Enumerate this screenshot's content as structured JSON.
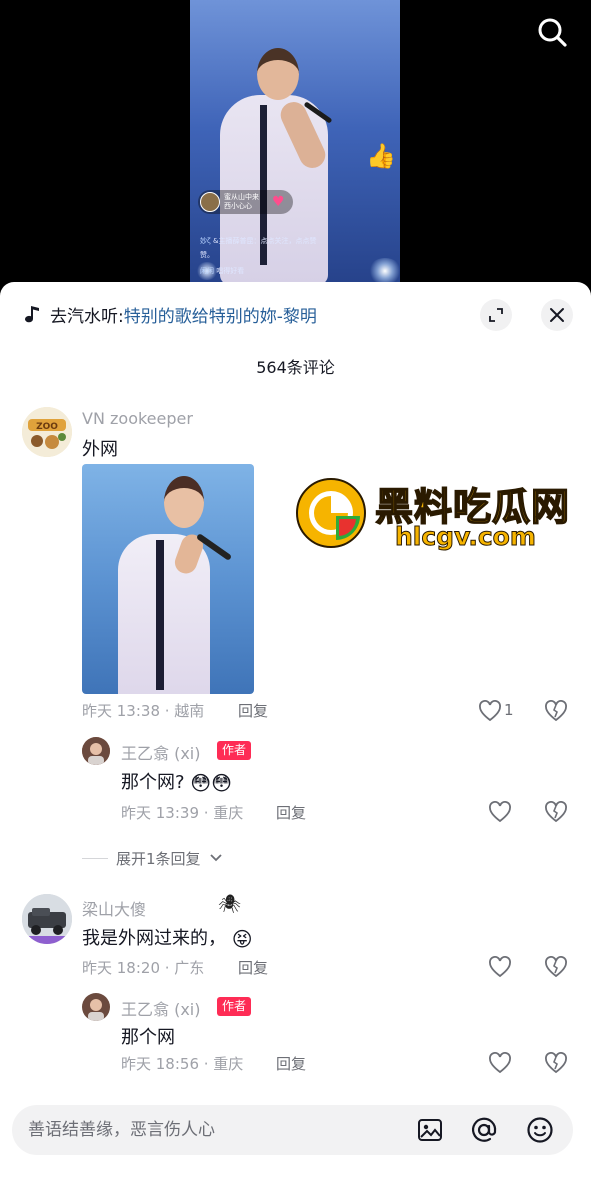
{
  "video": {
    "overlay_chip_name": "蜜从山中来",
    "overlay_chip_sub": "西小心心",
    "overlay_line1_name": "妙ζ",
    "overlay_line1_text": "&主播薛普昆：点点关注，点点赞",
    "overlay_line1b": "赞。",
    "overlay_line2_name": "闲闲",
    "overlay_line2_text": "唱得好看"
  },
  "music": {
    "prefix": "去汽水听:",
    "song": "特别的歌给特别的妳-黎明"
  },
  "comments_count": "564条评论",
  "watermark": {
    "title": "黑料吃瓜网",
    "url": "hlcgv.com"
  },
  "comments": [
    {
      "user": "VN zookeeper",
      "text": "外网",
      "time": "昨天 13:38 · 越南",
      "reply_label": "回复",
      "likes": "1",
      "replies": [
        {
          "user": "王乙翕 (xi)",
          "badge": "作者",
          "text": "那个网?",
          "time": "昨天 13:39 · 重庆",
          "reply_label": "回复"
        }
      ],
      "expand_label": "展开1条回复"
    },
    {
      "user": "梁山大傻",
      "text": "我是外网过来的，",
      "time": "昨天 18:20 · 广东",
      "reply_label": "回复",
      "replies": [
        {
          "user": "王乙翕 (xi)",
          "badge": "作者",
          "text": "那个网",
          "time": "昨天 18:56 · 重庆",
          "reply_label": "回复"
        }
      ]
    }
  ],
  "input": {
    "placeholder": "善语结善缘，恶言伤人心"
  },
  "colors": {
    "accent": "#fe2c55",
    "song_link": "#275f99",
    "meta": "#9fa1a8"
  }
}
